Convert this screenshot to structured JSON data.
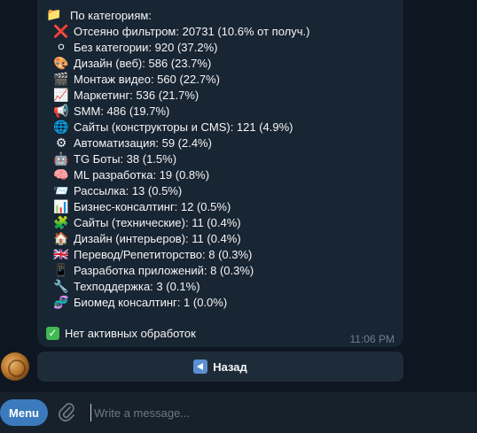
{
  "message": {
    "header": "По категориям:",
    "header_icon": "folder-icon",
    "categories": [
      {
        "icon": "❌",
        "icon_name": "cross-mark-icon",
        "text": "Отсеяно фильтром: 20731 (10.6% от получ.)"
      },
      {
        "icon": "⚪",
        "icon_name": "white-circle-icon",
        "text": "Без категории: 920 (37.2%)"
      },
      {
        "icon": "🎨",
        "icon_name": "palette-icon",
        "text": "Дизайн (веб): 586 (23.7%)"
      },
      {
        "icon": "🎬",
        "icon_name": "clapper-icon",
        "text": "Монтаж видео: 560 (22.7%)"
      },
      {
        "icon": "📈",
        "icon_name": "chart-up-icon",
        "text": "Маркетинг: 536 (21.7%)"
      },
      {
        "icon": "📢",
        "icon_name": "megaphone-icon",
        "text": "SMM: 486 (19.7%)"
      },
      {
        "icon": "🌐",
        "icon_name": "globe-icon",
        "text": "Сайты (конструкторы и CMS): 121 (4.9%)"
      },
      {
        "icon": "⚙",
        "icon_name": "gear-icon",
        "text": "Автоматизация: 59 (2.4%)"
      },
      {
        "icon": "🤖",
        "icon_name": "robot-icon",
        "text": "TG Боты: 38 (1.5%)"
      },
      {
        "icon": "🧠",
        "icon_name": "brain-icon",
        "text": "ML разработка: 19 (0.8%)"
      },
      {
        "icon": "📨",
        "icon_name": "envelope-icon",
        "text": "Рассылка: 13 (0.5%)"
      },
      {
        "icon": "📊",
        "icon_name": "bar-chart-icon",
        "text": "Бизнес-консалтинг: 12 (0.5%)"
      },
      {
        "icon": "🧩",
        "icon_name": "puzzle-icon",
        "text": "Сайты (технические): 11 (0.4%)"
      },
      {
        "icon": "🏠",
        "icon_name": "house-icon",
        "text": "Дизайн (интерьеров): 11 (0.4%)"
      },
      {
        "icon": "🇬🇧",
        "icon_name": "uk-flag-icon",
        "text": "Перевод/Репетиторство: 8 (0.3%)"
      },
      {
        "icon": "📱",
        "icon_name": "mobile-phone-icon",
        "text": "Разработка приложений: 8 (0.3%)"
      },
      {
        "icon": "🔧",
        "icon_name": "wrench-icon",
        "text": "Техподдержка: 3 (0.1%)"
      },
      {
        "icon": "🧬",
        "icon_name": "dna-icon",
        "text": "Биомед консалтинг: 1 (0.0%)"
      }
    ],
    "status_text": "Нет активных обработок",
    "time": "11:06 PM"
  },
  "inline_button": {
    "label": "Назад",
    "icon": "back-arrow-icon"
  },
  "composer": {
    "menu_label": "Menu",
    "placeholder": "Write a message..."
  },
  "colors": {
    "background": "#0e1621",
    "bubble": "#182533",
    "accent": "#3b7bbd",
    "text": "#f5f5f5"
  }
}
